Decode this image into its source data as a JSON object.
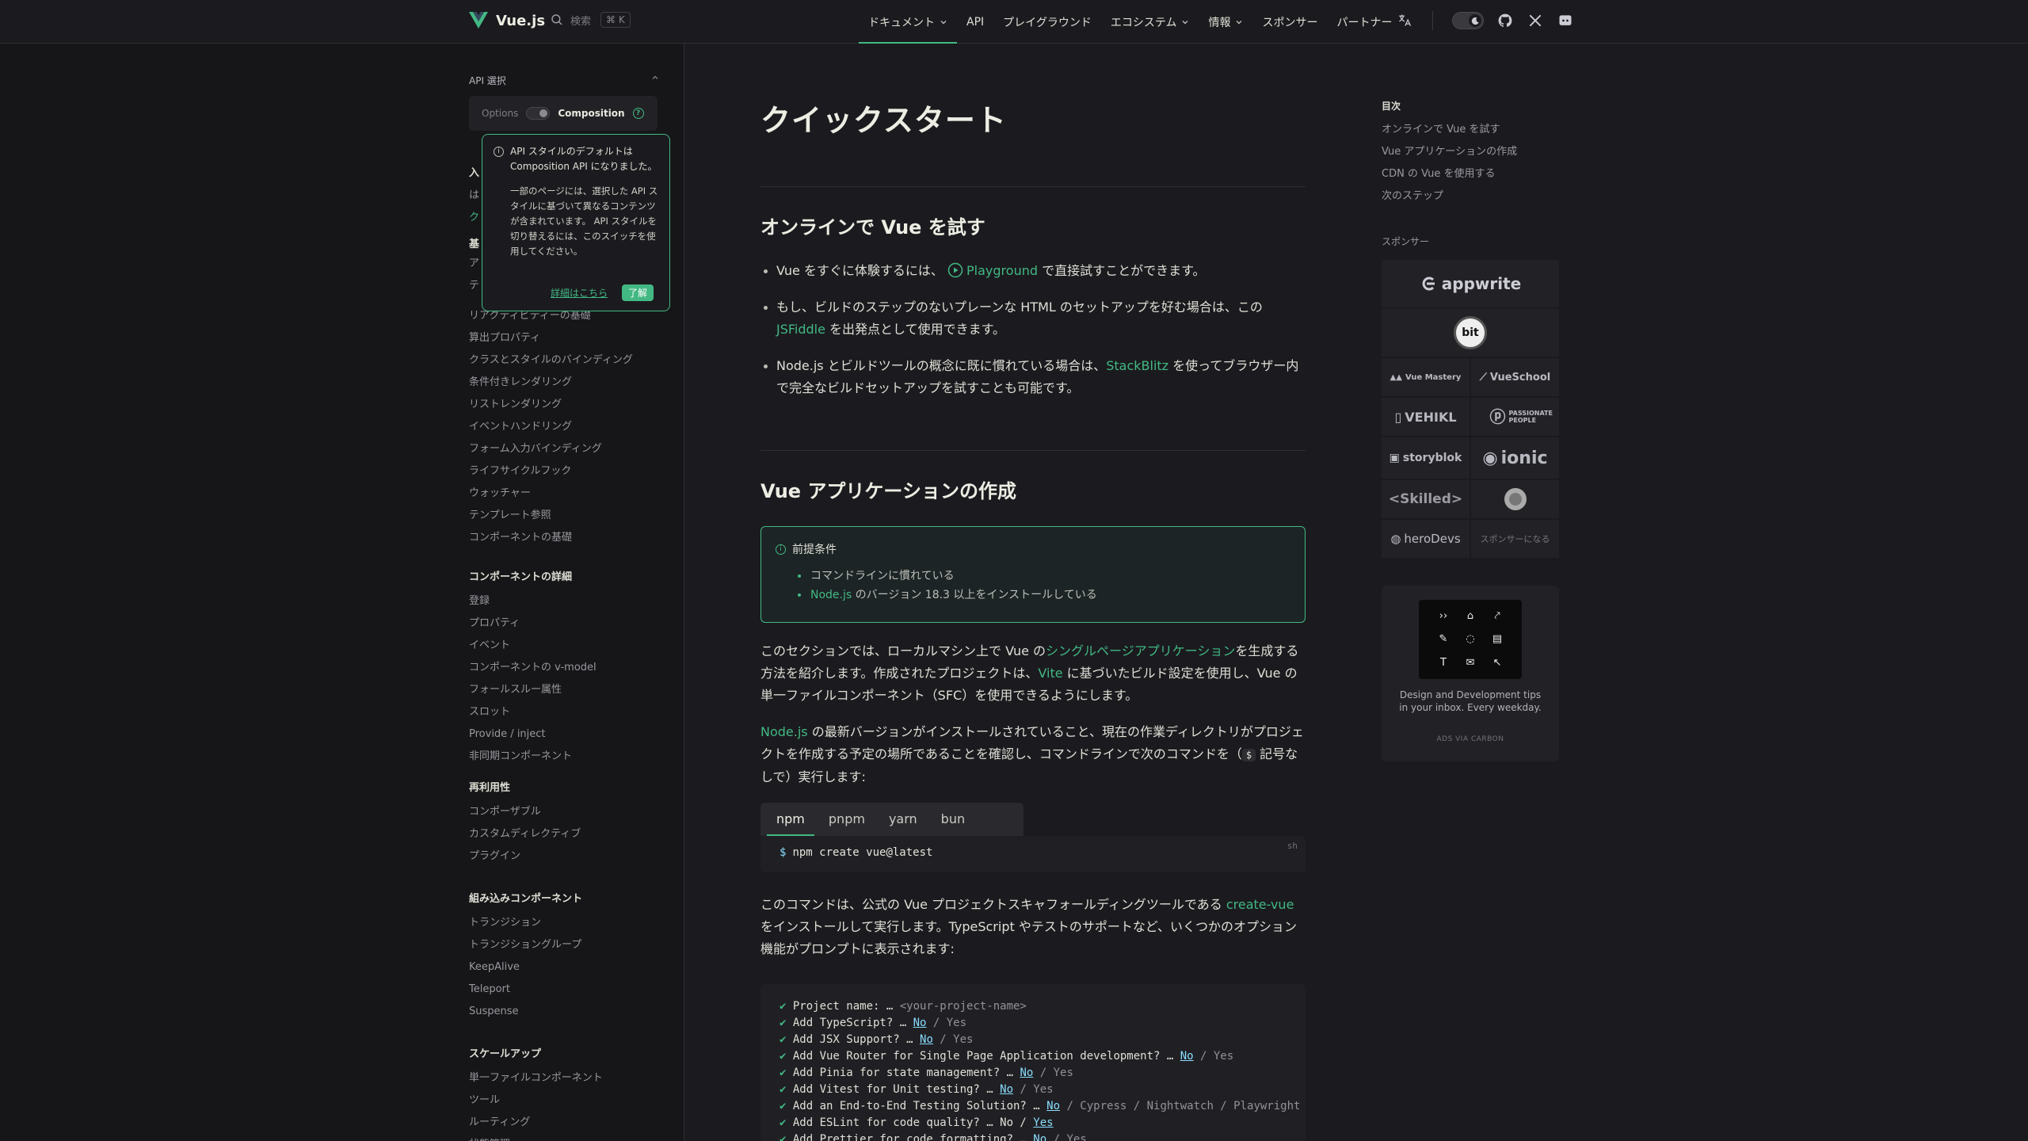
{
  "colors": {
    "brand": "#42b883",
    "bg": "#1b1b1f",
    "sidebar_bg": "#161618"
  },
  "nav": {
    "logo": "Vue.js",
    "search_label": "検索",
    "search_keys": "⌘ K",
    "links": [
      "ドキュメント",
      "API",
      "プレイグラウンド",
      "エコシステム",
      "情報",
      "スポンサー",
      "パートナー"
    ]
  },
  "sidebar": {
    "api_pref_title": "API 選択",
    "options_label": "Options",
    "composition_label": "Composition",
    "popover": {
      "line1": "API スタイルのデフォルトは Composition API になりました。",
      "line2": "一部のページには、選択した API スタイルに基づいて異なるコンテンツが含まれています。 API スタイルを切り替えるには、このスイッチを使用してください。",
      "more": "詳細はこちら",
      "ok": "了解"
    },
    "partial_items": [
      "入",
      "は",
      "ク",
      "基",
      "ア",
      "テ"
    ],
    "basics": [
      "リアクティビティーの基礎",
      "算出プロパティ",
      "クラスとスタイルのバインディング",
      "条件付きレンダリング",
      "リストレンダリング",
      "イベントハンドリング",
      "フォーム入力バインディング",
      "ライフサイクルフック",
      "ウォッチャー",
      "テンプレート参照",
      "コンポーネントの基礎"
    ],
    "components_title": "コンポーネントの詳細",
    "components": [
      "登録",
      "プロパティ",
      "イベント",
      "コンポーネントの v-model",
      "フォールスルー属性",
      "スロット",
      "Provide / inject",
      "非同期コンポーネント"
    ],
    "reuse_title": "再利用性",
    "reuse": [
      "コンポーザブル",
      "カスタムディレクティブ",
      "プラグイン"
    ],
    "builtin_title": "組み込みコンポーネント",
    "builtin": [
      "トランジション",
      "トランジショングループ",
      "KeepAlive",
      "Teleport",
      "Suspense"
    ],
    "scale_title": "スケールアップ",
    "scale": [
      "単一ファイルコンポーネント",
      "ツール",
      "ルーティング",
      "状態管理"
    ]
  },
  "main": {
    "title": "クイックスタート",
    "h2_online": "オンラインで Vue を試す",
    "b1_pre": "Vue をすぐに体験するには、",
    "b1_link": "Playground",
    "b1_post": " で直接試すことができます。",
    "b2_pre": "もし、ビルドのステップのないプレーンな HTML のセットアップを好む場合は、この ",
    "b2_link": "JSFiddle",
    "b2_post": " を出発点として使用できます。",
    "b3_pre": "Node.js とビルドツールの概念に既に慣れている場合は、",
    "b3_link": "StackBlitz",
    "b3_post": " を使ってブラウザー内で完全なビルドセットアップを試すことも可能です。",
    "h2_create": "Vue アプリケーションの作成",
    "tip_title": "前提条件",
    "tip_1": "コマンドラインに慣れている",
    "tip_2_link": "Node.js",
    "tip_2_post": " のバージョン 18.3 以上をインストールしている",
    "p1_pre": "このセクションでは、ローカルマシン上で Vue の",
    "p1_link1": "シングルページアプリケーション",
    "p1_mid": "を生成する方法を紹介します。作成されたプロジェクトは、",
    "p1_link2": "Vite",
    "p1_post": " に基づいたビルド設定を使用し、Vue の単一ファイルコンポーネント（SFC）を使用できるようにします。",
    "p2_link": "Node.js",
    "p2_mid": " の最新バージョンがインストールされていること、現在の作業ディレクトリがプロジェクトを作成する予定の場所であることを確認し、コマンドラインで次のコマンドを（",
    "p2_code": "$",
    "p2_post": " 記号なしで）実行します:",
    "tabs": [
      "npm",
      "pnpm",
      "yarn",
      "bun"
    ],
    "code_lang": "sh",
    "code_cmd": "npm create vue@latest",
    "p3_pre": "このコマンドは、公式の Vue プロジェクトスキャフォールディングツールである ",
    "p3_link": "create-vue",
    "p3_post": " をインストールして実行します。TypeScript やテストのサポートなど、いくつかのオプション機能がプロンプトに表示されます:",
    "term_lines": [
      {
        "q": "Project name: … ",
        "a": "",
        "rest": "<your-project-name>"
      },
      {
        "q": "Add TypeScript? … ",
        "a": "No",
        "rest": " / Yes"
      },
      {
        "q": "Add JSX Support? … ",
        "a": "No",
        "rest": " / Yes"
      },
      {
        "q": "Add Vue Router for Single Page Application development? … ",
        "a": "No",
        "rest": " / Yes"
      },
      {
        "q": "Add Pinia for state management? … ",
        "a": "No",
        "rest": " / Yes"
      },
      {
        "q": "Add Vitest for Unit testing? … ",
        "a": "No",
        "rest": " / Yes"
      },
      {
        "q": "Add an End-to-End Testing Solution? … ",
        "a": "No",
        "rest": " / Cypress / Nightwatch / Playwright"
      },
      {
        "q": "Add ESLint for code quality? … No / ",
        "a": "Yes",
        "rest": ""
      },
      {
        "q": "Add Prettier for code formatting? … ",
        "a": "No",
        "rest": " / Yes"
      }
    ]
  },
  "aside": {
    "toc_title": "目次",
    "toc": [
      "オンラインで Vue を試す",
      "Vue アプリケーションの作成",
      "CDN の Vue を使用する",
      "次のステップ"
    ],
    "sponsor_title": "スポンサー",
    "sponsors": [
      "appwrite",
      "bit",
      "Vue Mastery",
      "VueSchool",
      "VEHIKL",
      "PASSIONATE PEOPLE",
      "storyblok",
      "ionic",
      "<Skilled>",
      "heroDevs"
    ],
    "become_sponsor": "スポンサーになる",
    "ad_text": "Design and Development tips in your inbox. Every weekday.",
    "ad_via": "ADS VIA CARBON"
  }
}
